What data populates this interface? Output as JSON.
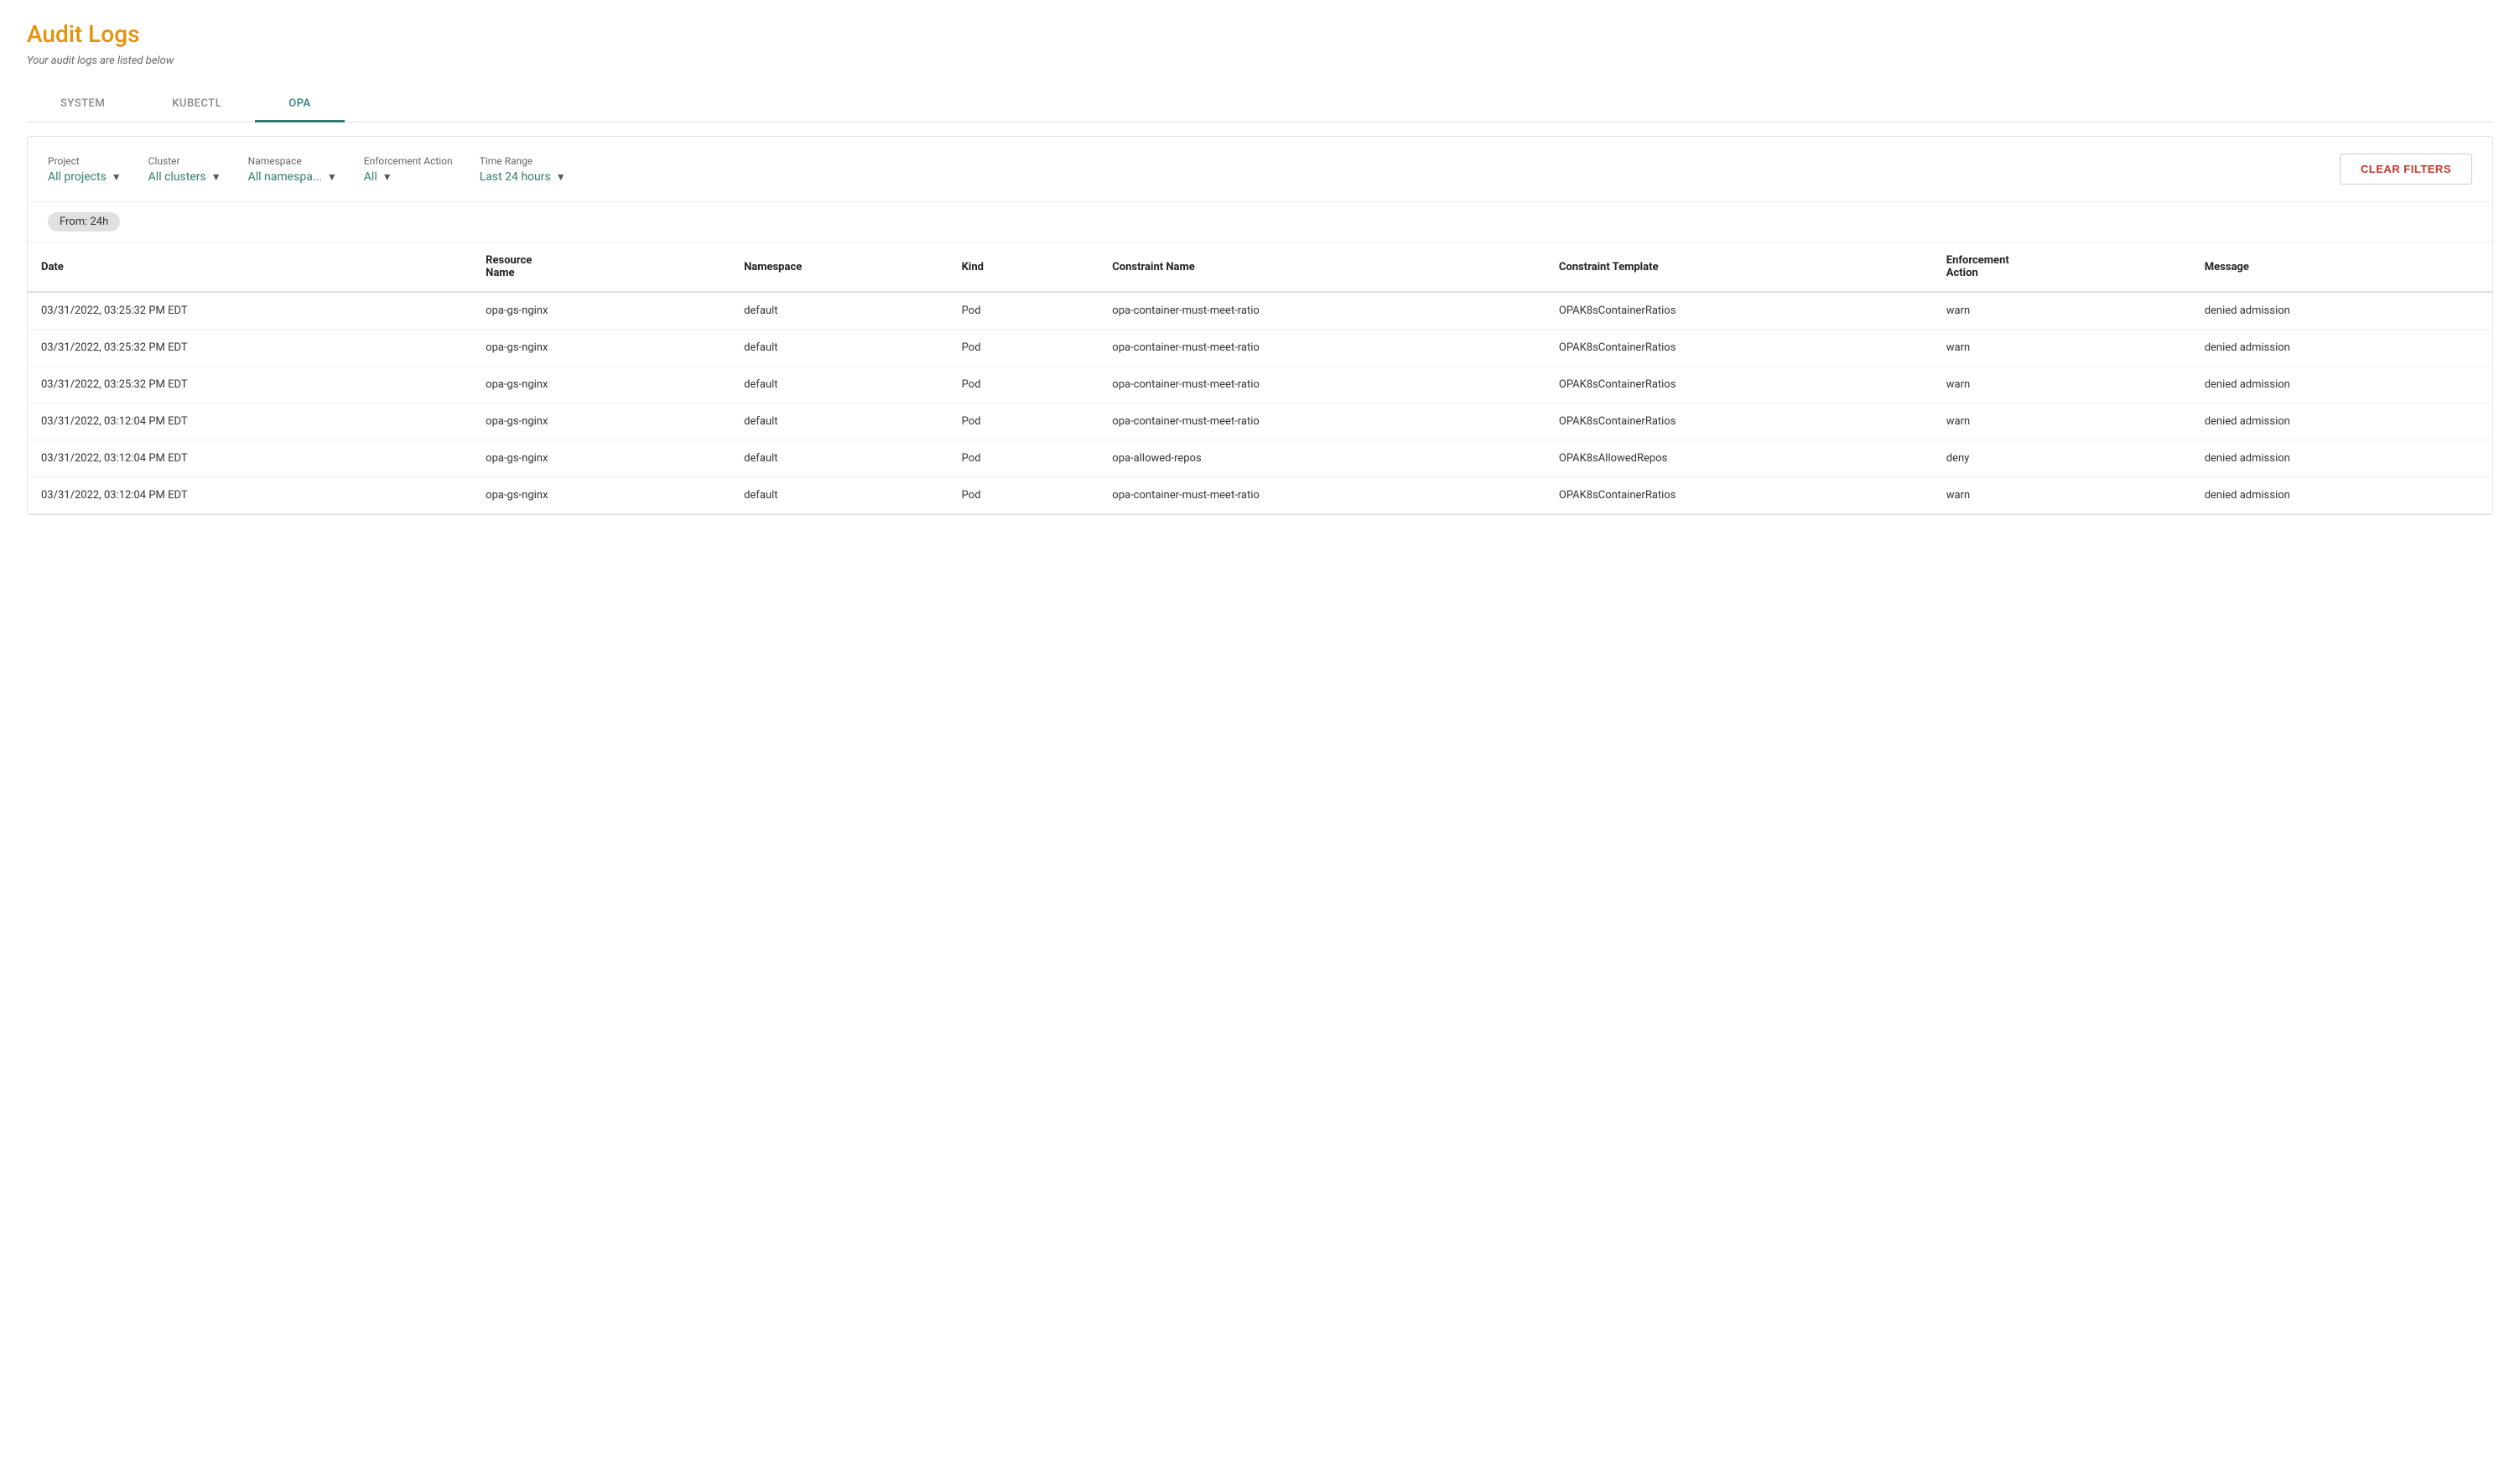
{
  "page": {
    "title": "Audit Logs",
    "subtitle": "Your audit logs are listed below"
  },
  "tabs": [
    {
      "id": "system",
      "label": "SYSTEM",
      "active": false
    },
    {
      "id": "kubectl",
      "label": "KUBECTL",
      "active": false
    },
    {
      "id": "opa",
      "label": "OPA",
      "active": true
    }
  ],
  "filters": {
    "project": {
      "label": "Project",
      "value": "All projects"
    },
    "cluster": {
      "label": "Cluster",
      "value": "All clusters"
    },
    "namespace": {
      "label": "Namespace",
      "value": "All namespa..."
    },
    "enforcement_action": {
      "label": "Enforcement Action",
      "value": "All"
    },
    "time_range": {
      "label": "Time Range",
      "value": "Last 24 hours"
    },
    "clear_filters_label": "CLEAR FILTERS"
  },
  "active_tag": "From: 24h",
  "table": {
    "columns": [
      {
        "id": "date",
        "label": "Date"
      },
      {
        "id": "resource_name",
        "label": "Resource Name"
      },
      {
        "id": "namespace",
        "label": "Namespace"
      },
      {
        "id": "kind",
        "label": "Kind"
      },
      {
        "id": "constraint_name",
        "label": "Constraint Name"
      },
      {
        "id": "constraint_template",
        "label": "Constraint Template"
      },
      {
        "id": "enforcement_action",
        "label": "Enforcement Action"
      },
      {
        "id": "message",
        "label": "Message"
      }
    ],
    "rows": [
      {
        "date": "03/31/2022, 03:25:32 PM EDT",
        "resource_name": "opa-gs-nginx",
        "namespace": "default",
        "kind": "Pod",
        "constraint_name": "opa-container-must-meet-ratio",
        "constraint_template": "OPAK8sContainerRatios",
        "enforcement_action": "warn",
        "message": "denied admission"
      },
      {
        "date": "03/31/2022, 03:25:32 PM EDT",
        "resource_name": "opa-gs-nginx",
        "namespace": "default",
        "kind": "Pod",
        "constraint_name": "opa-container-must-meet-ratio",
        "constraint_template": "OPAK8sContainerRatios",
        "enforcement_action": "warn",
        "message": "denied admission"
      },
      {
        "date": "03/31/2022, 03:25:32 PM EDT",
        "resource_name": "opa-gs-nginx",
        "namespace": "default",
        "kind": "Pod",
        "constraint_name": "opa-container-must-meet-ratio",
        "constraint_template": "OPAK8sContainerRatios",
        "enforcement_action": "warn",
        "message": "denied admission"
      },
      {
        "date": "03/31/2022, 03:12:04 PM EDT",
        "resource_name": "opa-gs-nginx",
        "namespace": "default",
        "kind": "Pod",
        "constraint_name": "opa-container-must-meet-ratio",
        "constraint_template": "OPAK8sContainerRatios",
        "enforcement_action": "warn",
        "message": "denied admission"
      },
      {
        "date": "03/31/2022, 03:12:04 PM EDT",
        "resource_name": "opa-gs-nginx",
        "namespace": "default",
        "kind": "Pod",
        "constraint_name": "opa-allowed-repos",
        "constraint_template": "OPAK8sAllowedRepos",
        "enforcement_action": "deny",
        "message": "denied admission"
      },
      {
        "date": "03/31/2022, 03:12:04 PM EDT",
        "resource_name": "opa-gs-nginx",
        "namespace": "default",
        "kind": "Pod",
        "constraint_name": "opa-container-must-meet-ratio",
        "constraint_template": "OPAK8sContainerRatios",
        "enforcement_action": "warn",
        "message": "denied admission"
      }
    ]
  }
}
